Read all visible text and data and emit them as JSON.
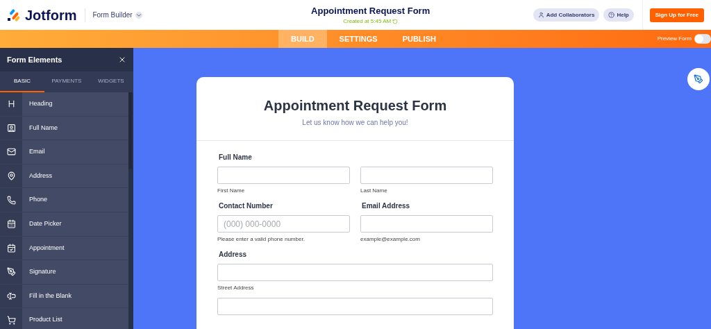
{
  "header": {
    "brand": "Jotform",
    "product": "Form Builder",
    "title": "Appointment Request Form",
    "subtitle": "Created at 5:45 AM",
    "buttons": [
      {
        "label": "Add Collaborators",
        "kind": "user"
      },
      {
        "label": "Help",
        "kind": "help"
      }
    ],
    "signup": "Sign Up for Free"
  },
  "nav": {
    "tabs": [
      {
        "label": "BUILD",
        "selected": true
      },
      {
        "label": "SETTINGS",
        "selected": false
      },
      {
        "label": "PUBLISH",
        "selected": false
      }
    ],
    "preview": {
      "label": "Preview Form",
      "on": false
    }
  },
  "sidebar": {
    "title": "Form Elements",
    "tabs": [
      {
        "label": "BASIC",
        "selected": true
      },
      {
        "label": "PAYMENTS",
        "selected": false
      },
      {
        "label": "WIDGETS",
        "selected": false
      }
    ],
    "items": [
      {
        "label": "Heading"
      },
      {
        "label": "Full Name"
      },
      {
        "label": "Email"
      },
      {
        "label": "Address"
      },
      {
        "label": "Phone"
      },
      {
        "label": "Date Picker"
      },
      {
        "label": "Appointment"
      },
      {
        "label": "Signature"
      },
      {
        "label": "Fill in the Blank"
      },
      {
        "label": "Product List"
      }
    ]
  },
  "form": {
    "title": "Appointment Request Form",
    "subtitle": "Let us know how we can help you!",
    "rows": [
      {
        "label": "Full Name",
        "fields": [
          {
            "sublabel": "First Name"
          },
          {
            "sublabel": "Last Name"
          }
        ]
      },
      {
        "columns": [
          {
            "label": "Contact Number",
            "placeholder": "(000) 000-0000",
            "sublabel": "Please enter a valid phone number."
          },
          {
            "label": "Email Address",
            "sublabel": "example@example.com"
          }
        ]
      },
      {
        "label": "Address",
        "fields": [
          {
            "sublabel": "Street Address"
          }
        ]
      },
      {
        "kind": "blank_input"
      }
    ]
  }
}
